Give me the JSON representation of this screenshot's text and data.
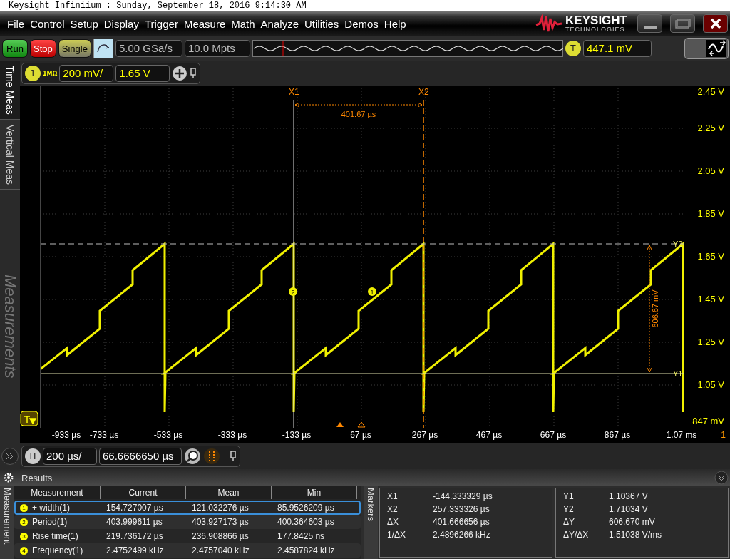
{
  "window": {
    "title": "Keysight Infiniium : Sunday, September 18, 2016 9:14:30 AM"
  },
  "menu": [
    "File",
    "Control",
    "Setup",
    "Display",
    "Trigger",
    "Measure",
    "Math",
    "Analyze",
    "Utilities",
    "Demos",
    "Help"
  ],
  "brand": {
    "name": "KEYSIGHT",
    "sub": "TECHNOLOGIES"
  },
  "toolbar": {
    "buttons": [
      {
        "label": "Run",
        "kind": "run"
      },
      {
        "label": "Stop",
        "kind": "stop"
      },
      {
        "label": "Single",
        "kind": "single"
      }
    ],
    "sample_rate": "5.00 GSa/s",
    "memory": "10.0 Mpts",
    "trigger_badge": "T",
    "trigger_level": "447.1 mV"
  },
  "side_tabs": [
    {
      "label": "Time Meas",
      "selected": true
    },
    {
      "label": "Vertical Meas",
      "selected": false
    }
  ],
  "side_watermark": "Measurements",
  "channel": {
    "badge": "1",
    "impedance": "1MΩ",
    "scale": "200 mV/",
    "offset": "1.65 V"
  },
  "scope": {
    "y_ticks": [
      "2.45 V",
      "2.25 V",
      "2.05 V",
      "1.85 V",
      "1.65 V",
      "1.45 V",
      "1.25 V",
      "1.05 V",
      "847 mV"
    ],
    "x_ticks": [
      "-933 µs",
      "-733 µs",
      "-533 µs",
      "-333 µs",
      "-133 µs",
      "67 µs",
      "267 µs",
      "467 µs",
      "667 µs",
      "867 µs",
      "1.07 ms"
    ],
    "x_axis_channel": "1",
    "cursors": {
      "x1": "X1",
      "x2": "X2",
      "dx": "401.67 µs",
      "y1": "Y1",
      "y2": "Y2",
      "dy": "606.67 mV"
    },
    "meas_markers": [
      "2",
      "1"
    ]
  },
  "horizontal": {
    "badge": "H",
    "scale": "200 µs/",
    "position": "66.6666650 µs"
  },
  "results": {
    "title": "Results",
    "tab": "Measurement",
    "columns": [
      "Measurement",
      "Current",
      "Mean",
      "Min"
    ],
    "rows": [
      {
        "index": "1",
        "cells": [
          "+ width(1)",
          "154.727007 µs",
          "121.032276 µs",
          "85.9526209 µs"
        ],
        "selected": true
      },
      {
        "index": "2",
        "cells": [
          "Period(1)",
          "403.999611 µs",
          "403.927173 µs",
          "400.364603 µs"
        ],
        "selected": false
      },
      {
        "index": "3",
        "cells": [
          "Rise time(1)",
          "219.736172 µs",
          "236.908866 µs",
          "177.8425 ns"
        ],
        "selected": false
      },
      {
        "index": "4",
        "cells": [
          "Frequency(1)",
          "2.4752499 kHz",
          "2.4757040 kHz",
          "2.4587824 kHz"
        ],
        "selected": false
      }
    ]
  },
  "markers": {
    "tab": "Markers",
    "left": [
      {
        "label": "X1",
        "value": "-144.333329 µs"
      },
      {
        "label": "X2",
        "value": "257.333326 µs"
      },
      {
        "label": "ΔX",
        "value": "401.666656 µs"
      },
      {
        "label": "1/ΔX",
        "value": "2.4896266 kHz"
      }
    ],
    "right": [
      {
        "label": "Y1",
        "value": "1.10367 V"
      },
      {
        "label": "Y2",
        "value": "1.71034 V"
      },
      {
        "label": "ΔY",
        "value": "606.670 mV"
      },
      {
        "label": "ΔY/ΔX",
        "value": "1.51038 V/ms"
      }
    ]
  }
}
